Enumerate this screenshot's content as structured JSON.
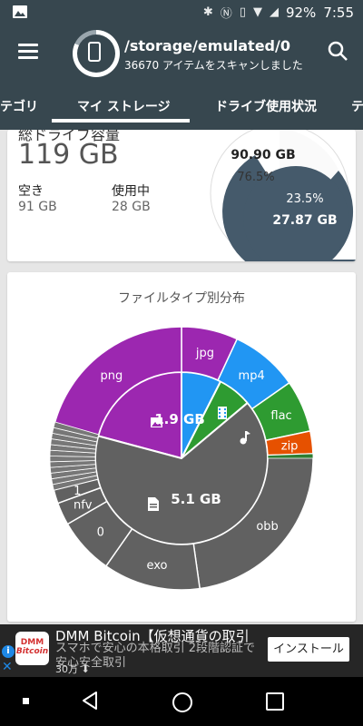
{
  "status_bar": {
    "battery": "92%",
    "time": "7:55"
  },
  "app_bar": {
    "path": "/storage/emulated/0",
    "subtitle": "36670 アイテムをスキャンしました"
  },
  "tabs": [
    {
      "label": "テゴリ",
      "selected": false
    },
    {
      "label": "マイ ストレージ",
      "selected": true
    },
    {
      "label": "ドライブ使用状況",
      "selected": false
    },
    {
      "label": "テ",
      "selected": false
    }
  ],
  "storage_card": {
    "total_label": "総ドライブ容量",
    "total_value": "119 GB",
    "free_label": "空き",
    "free_value": "91 GB",
    "used_label": "使用中",
    "used_value": "28 GB",
    "free_size_label": "90.90 GB",
    "free_percent_label": "76.5%",
    "used_percent_label": "23.5%",
    "used_size_label": "27.87 GB"
  },
  "chart_data": {
    "type": "pie",
    "title": "ファイルタイプ別分布",
    "inner_ring": [
      {
        "label": "1.9 GB",
        "color": "#9c27b0",
        "icon": "image-icon"
      },
      {
        "label": "",
        "color": "#2196f3",
        "icon": "video-icon"
      },
      {
        "label": "",
        "color": "#2e9b31",
        "icon": "music-icon"
      },
      {
        "label": "5.1 GB",
        "color": "#616161",
        "icon": "document-icon"
      }
    ],
    "outer_ring": [
      {
        "label": "jpg",
        "color": "#9c27b0"
      },
      {
        "label": "mp4",
        "color": "#2196f3"
      },
      {
        "label": "flac",
        "color": "#2e9b31"
      },
      {
        "label": "zip",
        "color": "#e65100"
      },
      {
        "label": "obb",
        "color": "#616161"
      },
      {
        "label": "exo",
        "color": "#616161"
      },
      {
        "label": "0",
        "color": "#616161"
      },
      {
        "label": "nfv",
        "color": "#616161"
      },
      {
        "label": "1",
        "color": "#616161"
      },
      {
        "label": "png",
        "color": "#9c27b0"
      }
    ]
  },
  "ad": {
    "title": "DMM Bitcoin【仮想通貨の取引",
    "description": "スマホで安心の本格取引 2段階認証で安心安全取引",
    "count": "30万",
    "logo_text": "DMM Bitcoin",
    "install_label": "インストール"
  }
}
